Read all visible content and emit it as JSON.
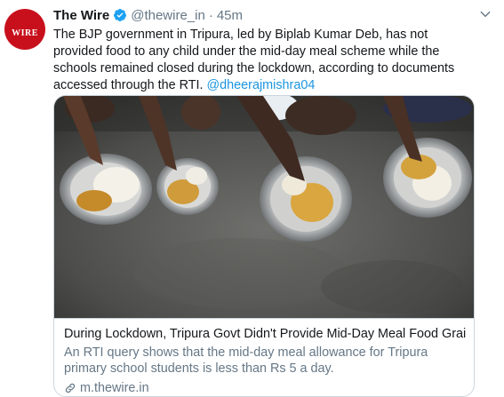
{
  "tweet": {
    "author_name": "The Wire",
    "handle": "@thewire_in",
    "separator": "·",
    "time": "45m",
    "text": "The BJP government in Tripura, led by Biplab Kumar Deb, has not provided food to any child under the mid-day meal scheme while the schools remained closed during the lockdown, according to documents accessed through the RTI.",
    "mention": "@dheerajmishra04",
    "avatar_text": "WIRE",
    "verified_icon": "verified-badge-icon",
    "more_icon": "chevron-down-icon"
  },
  "card": {
    "title": "During Lockdown, Tripura Govt Didn't Provide Mid-Day Meal Food Grai...",
    "description": "An RTI query shows that the mid-day meal allowance for Tripura primary school students is less than Rs 5 a day.",
    "domain": "m.thewire.in",
    "link_icon": "link-icon"
  },
  "colors": {
    "accent": "#1b95e0",
    "secondary_text": "#657786",
    "border": "#ccd6dd",
    "avatar_bg": "#c8101c"
  }
}
